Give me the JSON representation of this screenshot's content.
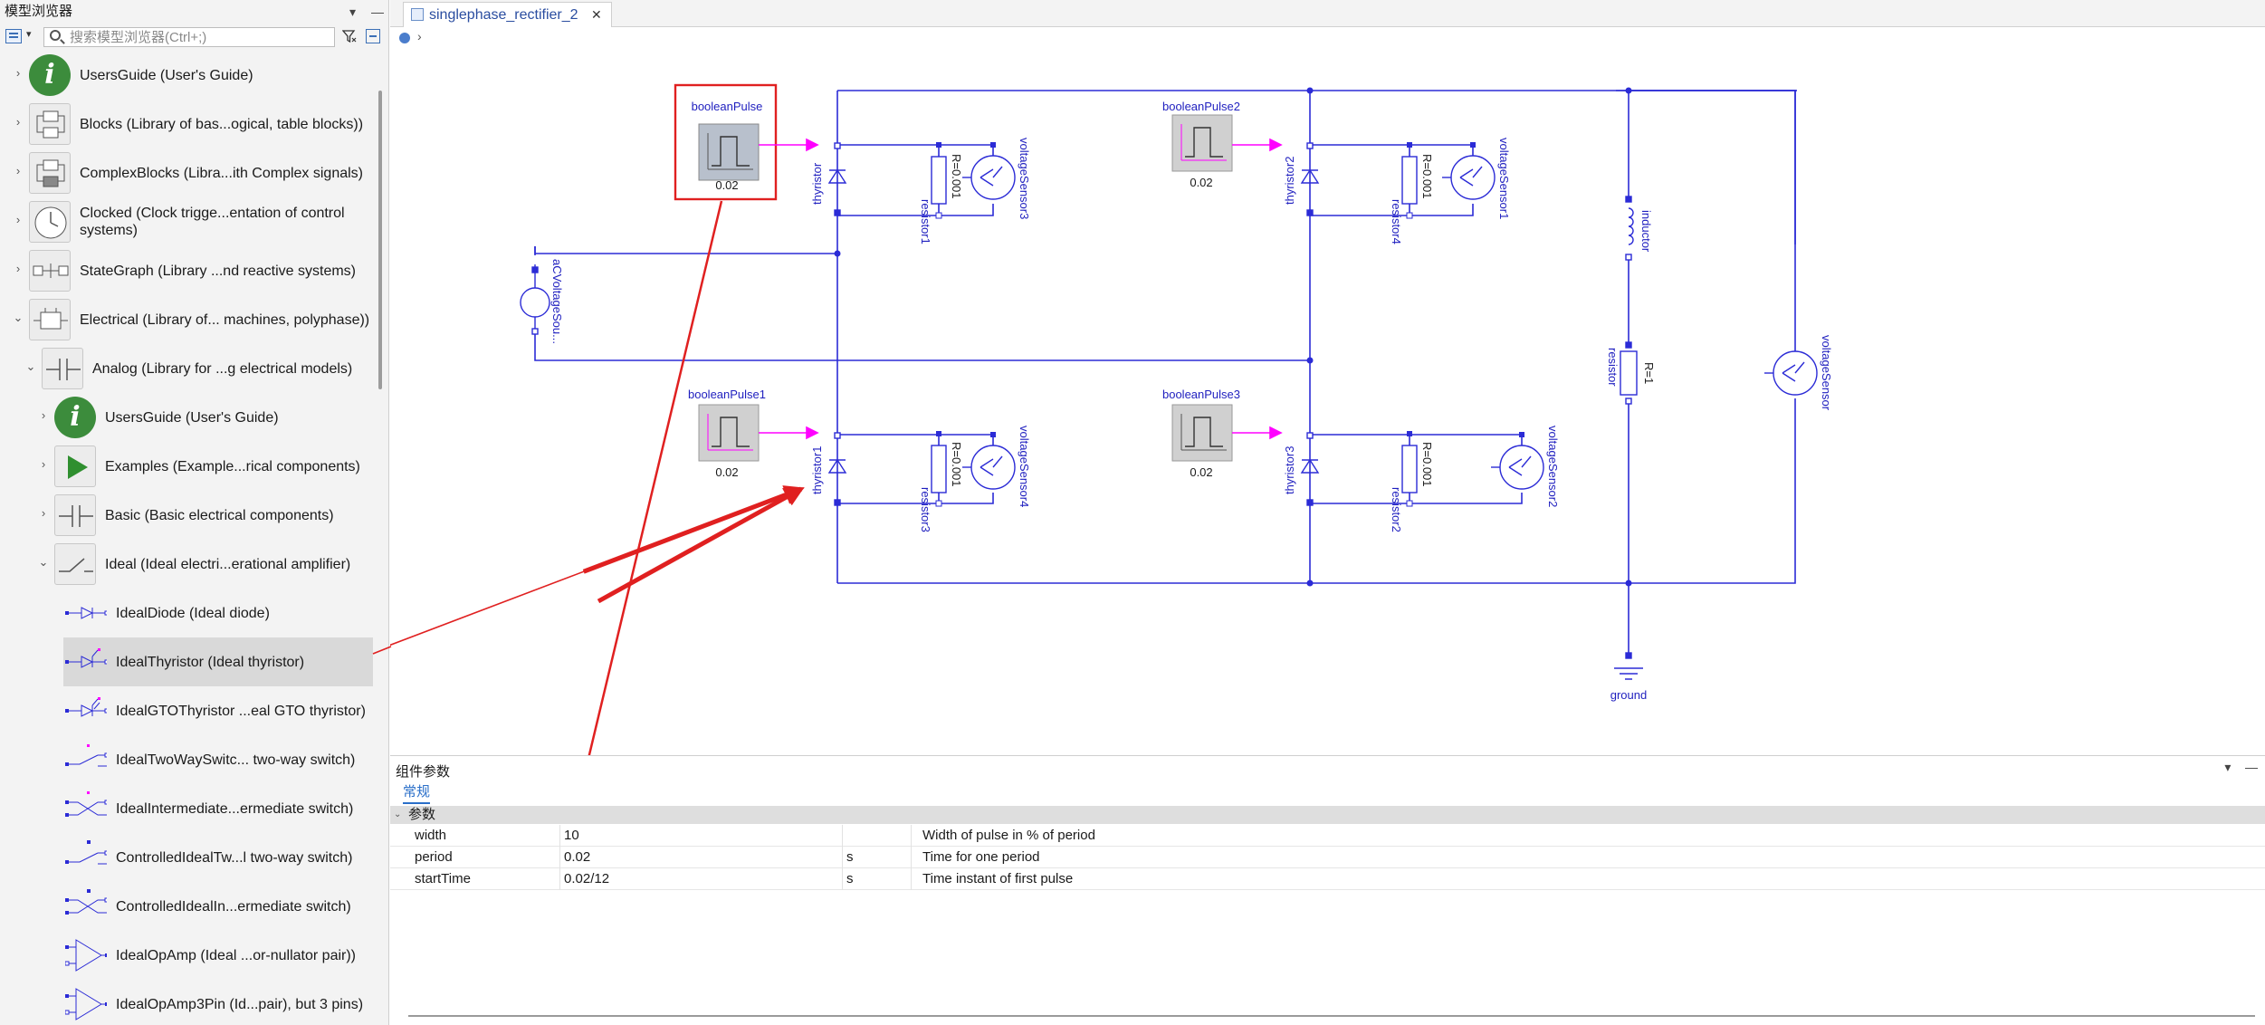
{
  "browser": {
    "title": "模型浏览器",
    "search_placeholder": "搜索模型浏览器(Ctrl+;)",
    "items": [
      {
        "label": "UsersGuide (User's Guide)"
      },
      {
        "label": "Blocks (Library of bas...ogical, table blocks))"
      },
      {
        "label": "ComplexBlocks (Libra...ith Complex signals)"
      },
      {
        "label": "Clocked (Clock trigge...entation of control systems)"
      },
      {
        "label": "StateGraph (Library ...nd reactive systems)"
      },
      {
        "label": "Electrical (Library of... machines, polyphase))"
      },
      {
        "label": "Analog (Library for ...g electrical models)"
      },
      {
        "label": "UsersGuide (User's Guide)"
      },
      {
        "label": "Examples (Example...rical components)"
      },
      {
        "label": "Basic (Basic electrical components)"
      },
      {
        "label": "Ideal (Ideal electri...erational amplifier)"
      },
      {
        "label": "IdealDiode (Ideal diode)"
      },
      {
        "label": "IdealThyristor (Ideal thyristor)"
      },
      {
        "label": "IdealGTOThyristor ...eal GTO thyristor)"
      },
      {
        "label": "IdealTwoWaySwitc... two-way switch)"
      },
      {
        "label": "IdealIntermediate...ermediate switch)"
      },
      {
        "label": "ControlledIdealTw...l two-way switch)"
      },
      {
        "label": "ControlledIdealIn...ermediate switch)"
      },
      {
        "label": "IdealOpAmp (Ideal ...or-nullator pair))"
      },
      {
        "label": "IdealOpAmp3Pin (Id...pair), but 3 pins)"
      }
    ]
  },
  "editor": {
    "tab_label": "singlephase_rectifier_2",
    "diagram": {
      "pulse_labels": [
        "booleanPulse",
        "booleanPulse1",
        "booleanPulse2",
        "booleanPulse3"
      ],
      "pulse_period": "0.02",
      "thyristor_labels": [
        "thyristor",
        "thyristor1",
        "thyristor2",
        "thyristor3"
      ],
      "resistor_small_labels": [
        "resistor1",
        "resistor3",
        "resistor4",
        "resistor2"
      ],
      "resistor_small_value": "R=0.001",
      "sensor_labels": [
        "voltageSensor3",
        "voltageSensor4",
        "voltageSensor1",
        "voltageSensor2",
        "voltageSensor"
      ],
      "source_label": "aCVoltageSou...",
      "inductor_label": "inductor",
      "resistor_label": "resistor",
      "resistor_value": "R=1",
      "ground_label": "ground"
    }
  },
  "params": {
    "title": "组件参数",
    "tab_general": "常规",
    "group_label": "参数",
    "rows": [
      {
        "name": "width",
        "value": "10",
        "unit": "",
        "desc": "Width of pulse in % of period"
      },
      {
        "name": "period",
        "value": "0.02",
        "unit": "s",
        "desc": "Time for one period"
      },
      {
        "name": "startTime",
        "value": "0.02/12",
        "unit": "s",
        "desc": "Time instant of first pulse"
      }
    ]
  },
  "colors": {
    "wire": "#2b2bd6",
    "boolean_signal": "#ff00ff",
    "annotation_red": "#e02020",
    "accent_blue": "#2a6fc9"
  }
}
